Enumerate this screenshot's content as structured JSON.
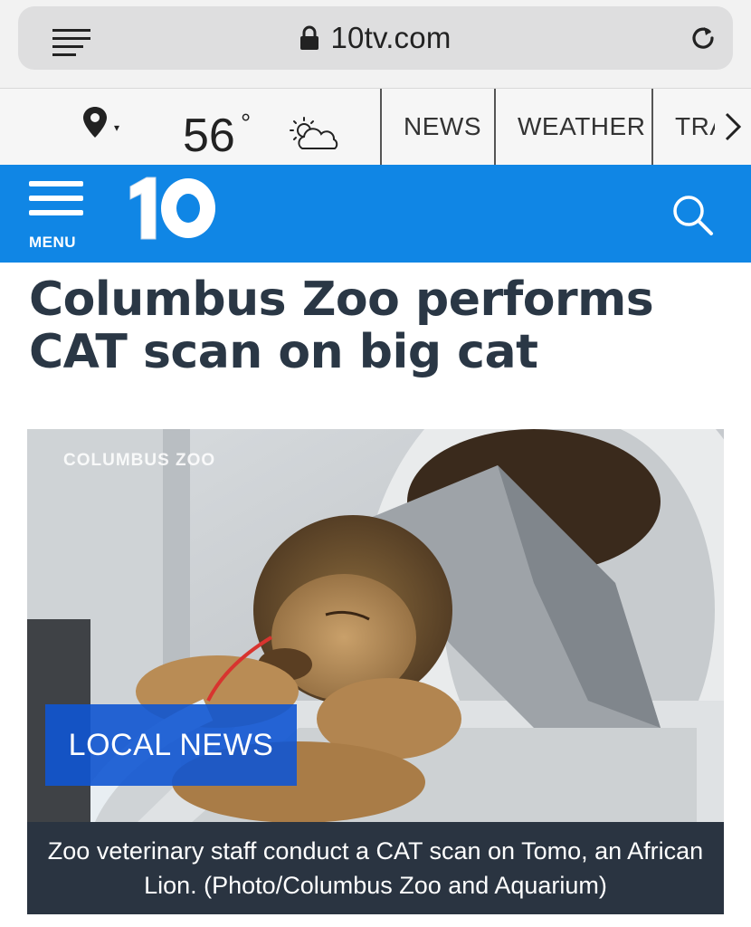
{
  "browser": {
    "url": "10tv.com",
    "icons": [
      "menu-icon",
      "lock-icon",
      "reload-icon"
    ]
  },
  "weather_bar": {
    "temperature": "56",
    "degree_symbol": "°",
    "condition_icon": "partly-cloudy-icon",
    "location_caret": "▾",
    "tabs": [
      {
        "label": "NEWS"
      },
      {
        "label": "WEATHER"
      },
      {
        "label": "TRA"
      }
    ]
  },
  "header": {
    "menu_label": "MENU",
    "logo_text": "10",
    "brand_color": "#1086e5"
  },
  "article": {
    "headline": "Columbus Zoo performs CAT scan on big cat",
    "photo": {
      "watermark": "COLUMBUS ZOO",
      "badge": "LOCAL NEWS",
      "caption": "Zoo veterinary staff conduct a CAT scan on Tomo, an African Lion. (Photo/Columbus Zoo and Aquarium)"
    }
  }
}
